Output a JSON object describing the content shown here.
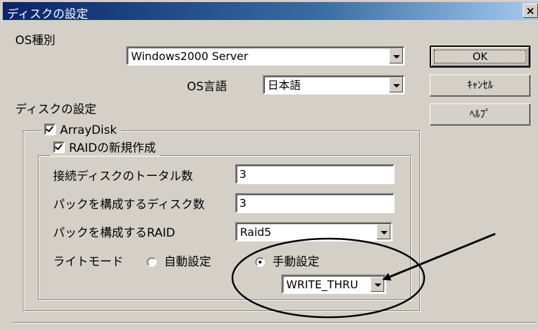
{
  "window": {
    "title": "ディスクの設定",
    "close_label": "×"
  },
  "os_type": {
    "label": "OS種別",
    "value": "Windows2000 Server"
  },
  "os_lang": {
    "label": "OS言語",
    "value": "日本語"
  },
  "buttons": {
    "ok": "OK",
    "cancel": "ｷｬﾝｾﾙ",
    "help": "ﾍﾙﾌﾟ"
  },
  "disk_settings": {
    "label": "ディスクの設定"
  },
  "array_disk": {
    "label": "ArrayDisk",
    "checked": true
  },
  "raid_new": {
    "label": "RAIDの新規作成",
    "checked": true
  },
  "total_disks": {
    "label": "接続ディスクのトータル数",
    "value": "3"
  },
  "pack_disks": {
    "label": "パックを構成するディスク数",
    "value": "3"
  },
  "pack_raid": {
    "label": "パックを構成するRAID",
    "value": "Raid5"
  },
  "write_mode": {
    "label": "ライトモード",
    "auto_label": "自動設定",
    "manual_label": "手動設定",
    "selected": "manual",
    "value": "WRITE_THRU"
  },
  "colors": {
    "dialog_bg": "#d4d0c8",
    "title_gradient_start": "#0a246a",
    "title_gradient_end": "#a6caf0"
  }
}
